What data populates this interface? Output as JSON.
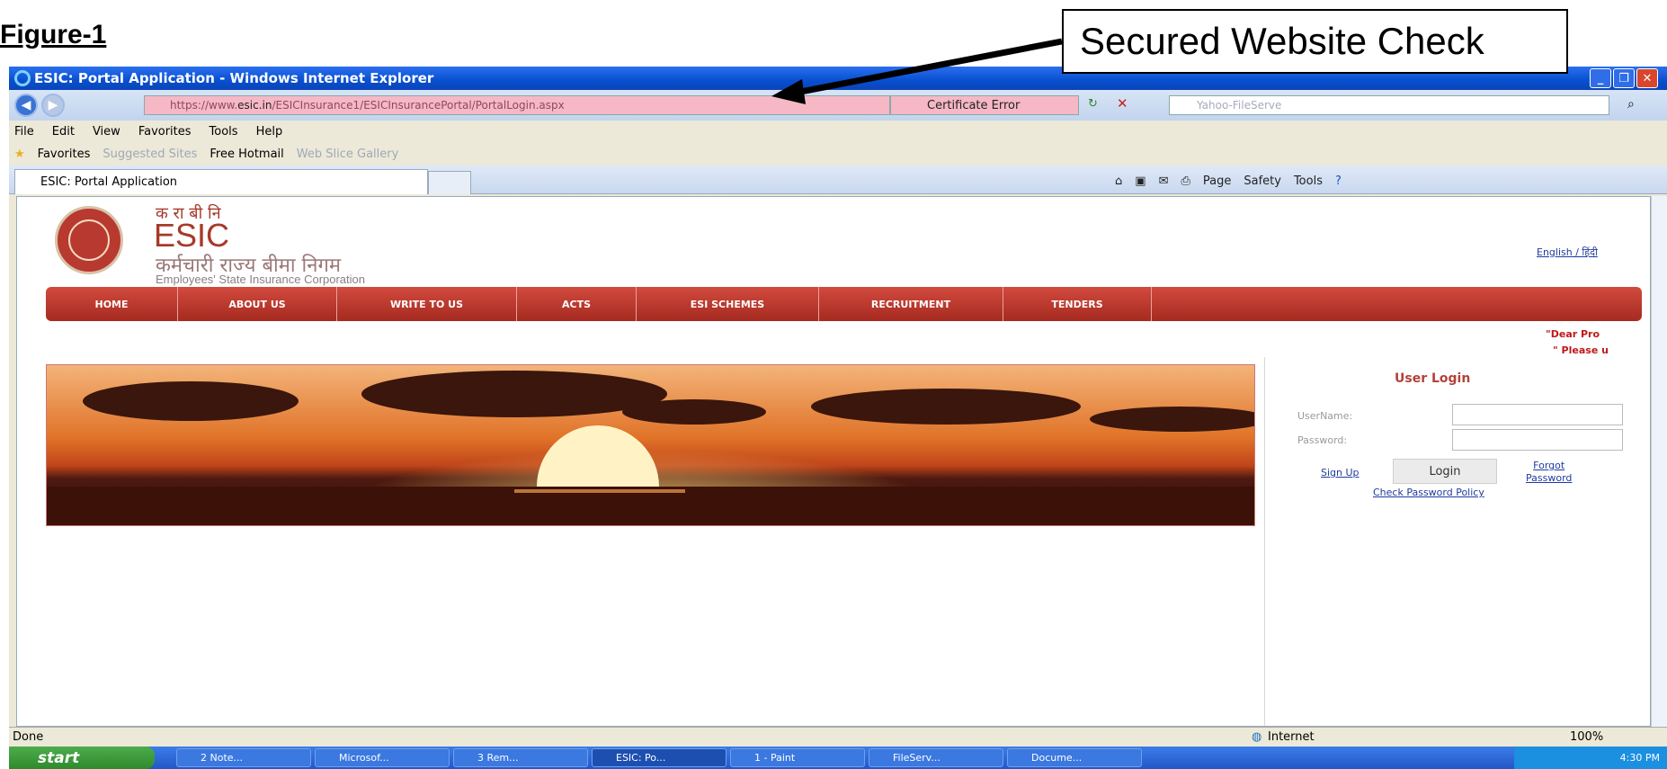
{
  "figure_label": "Figure-1",
  "callout": {
    "text": "Secured Website Check"
  },
  "window": {
    "title": "ESIC: Portal Application - Windows Internet Explorer"
  },
  "address_bar": {
    "url_domain": "esic.in",
    "cert_error": "Certificate Error",
    "search_placeholder": "Yahoo-FileServe"
  },
  "menu": {
    "items": [
      "File",
      "Edit",
      "View",
      "Favorites",
      "Tools",
      "Help"
    ]
  },
  "favorites_bar": {
    "favorites": "Favorites",
    "suggested": "Suggested Sites",
    "hotmail": "Free Hotmail",
    "webslice": "Web Slice Gallery"
  },
  "tab": {
    "label": "ESIC: Portal Application"
  },
  "command_bar": {
    "page": "Page",
    "safety": "Safety",
    "tools": "Tools"
  },
  "site": {
    "hindi_abbr": "क रा बी नि",
    "logo_text": "ESIC",
    "hindi_name": "कर्मचारी राज्य बीमा निगम",
    "english_name": "Employees' State Insurance Corporation",
    "lang_links": "English / हिंदी",
    "nav": [
      "HOME",
      "ABOUT US",
      "WRITE TO US",
      "ACTS",
      "ESI SCHEMES",
      "RECRUITMENT",
      "TENDERS"
    ],
    "notice1": "\"Dear Pro",
    "notice2": "\" Please u"
  },
  "login": {
    "title": "User Login",
    "username_label": "UserName:",
    "password_label": "Password:",
    "signup": "Sign Up",
    "login_button": "Login",
    "forgot1": "Forgot",
    "forgot2": "Password",
    "policy": "Check Password Policy"
  },
  "status": {
    "text": "Done",
    "zone": "Internet",
    "zoom": "100%"
  },
  "taskbar": {
    "start": "start",
    "tasks": [
      "2 Note...",
      "Microsof...",
      "3 Rem...",
      "ESIC: Po...",
      "1 - Paint",
      "FileServ...",
      "Docume..."
    ],
    "clock": "4:30 PM"
  },
  "colors": {
    "brand_red": "#b8392f",
    "nav_red": "#c0392b",
    "link_blue": "#1f3aa0",
    "xp_blue": "#0a50d8"
  }
}
